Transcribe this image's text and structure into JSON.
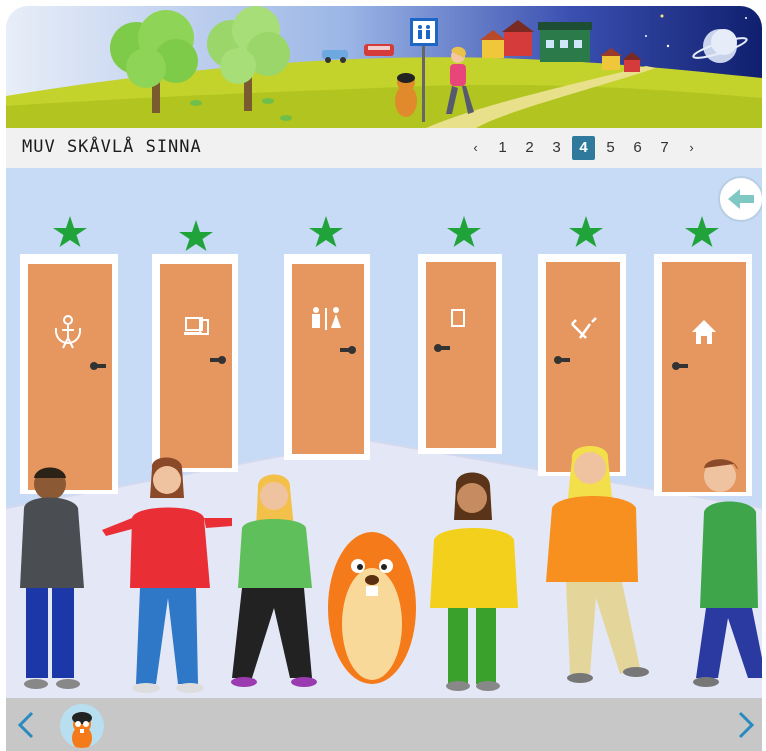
{
  "header": {
    "title": "MUV SKÅVLÅ SINNA"
  },
  "pagination": {
    "prev": "‹",
    "next": "›",
    "pages": [
      "1",
      "2",
      "3",
      "4",
      "5",
      "6",
      "7"
    ],
    "current": "4"
  },
  "scene": {
    "doors": [
      {
        "icon": "jump-rope-icon",
        "star": true
      },
      {
        "icon": "computer-icon",
        "star": true
      },
      {
        "icon": "toilet-icon",
        "star": true
      },
      {
        "icon": "notebook-icon",
        "star": true
      },
      {
        "icon": "tools-icon",
        "star": true
      },
      {
        "icon": "house-icon",
        "star": true
      }
    ],
    "characters": [
      "boy-dark-sweater",
      "girl-red-sweater",
      "girl-green-sweater",
      "beaver-mascot",
      "girl-yellow-sweater",
      "girl-orange-sweater",
      "boy-green-hoodie"
    ]
  },
  "colors": {
    "door": "#e6975f",
    "star": "#1fa33a",
    "active_page": "#2f7a9c",
    "wall": "#c8dbf6",
    "floor": "#e4e7f6"
  }
}
